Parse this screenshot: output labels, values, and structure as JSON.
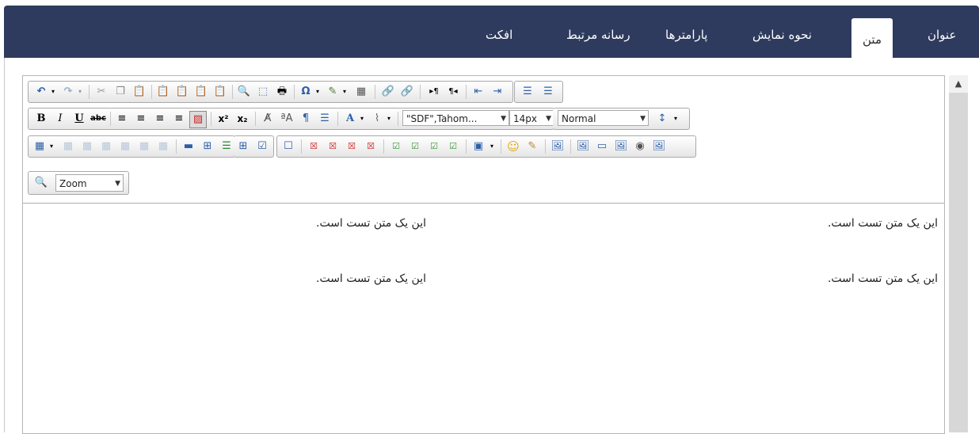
{
  "tabs": [
    {
      "label": "عنوان"
    },
    {
      "label": "متن"
    },
    {
      "label": "نحوه نمایش"
    },
    {
      "label": "پارامترها"
    },
    {
      "label": "رسانه مرتبط"
    },
    {
      "label": "افکت"
    }
  ],
  "active_tab": "متن",
  "toolbar": {
    "font_family": "\"SDF\",Tahom...",
    "font_size": "14px",
    "format": "Normal",
    "zoom": "Zoom"
  },
  "editor": {
    "lines": [
      {
        "right": "این یک متن تست است.",
        "left": "این یک متن تست است."
      },
      {
        "right": "این یک متن تست است.",
        "left": "این یک متن تست است."
      }
    ]
  },
  "colors": {
    "header_bg": "#2e3b5e",
    "accent_red": "#cc2222",
    "accent_blue": "#2d5fa8",
    "accent_green": "#3a9a3a"
  }
}
